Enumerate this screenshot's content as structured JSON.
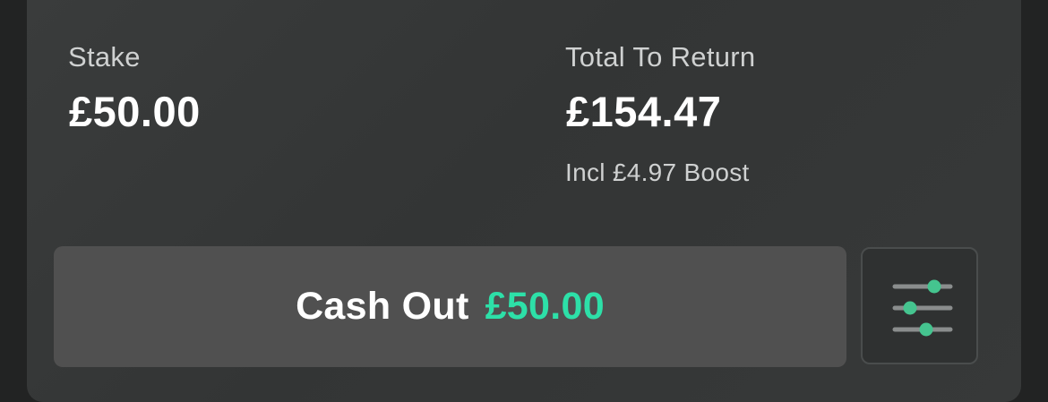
{
  "stake": {
    "label": "Stake",
    "amount": "£50.00"
  },
  "total_return": {
    "label": "Total To Return",
    "amount": "£154.47",
    "boost_note": "Incl £4.97 Boost"
  },
  "cash_out": {
    "label": "Cash Out",
    "value": "£50.00"
  },
  "settings_icon": "sliders-icon",
  "colors": {
    "accent": "#2de0a8",
    "button_bg": "#505050"
  }
}
